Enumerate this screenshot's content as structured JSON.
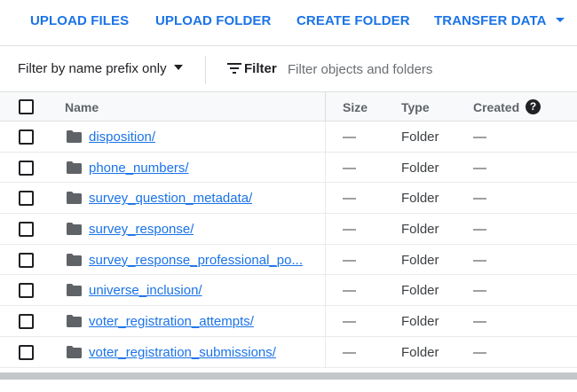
{
  "toolbar": {
    "upload_files": "UPLOAD FILES",
    "upload_folder": "UPLOAD FOLDER",
    "create_folder": "CREATE FOLDER",
    "transfer_data": "TRANSFER DATA"
  },
  "filterbar": {
    "prefix_option": "Filter by name prefix only",
    "filter_label": "Filter",
    "filter_placeholder": "Filter objects and folders"
  },
  "table": {
    "columns": {
      "name": "Name",
      "size": "Size",
      "type": "Type",
      "created": "Created"
    },
    "help_glyph": "?",
    "rows": [
      {
        "name": "disposition/",
        "size": "—",
        "type": "Folder",
        "created": "—"
      },
      {
        "name": "phone_numbers/",
        "size": "—",
        "type": "Folder",
        "created": "—"
      },
      {
        "name": "survey_question_metadata/",
        "size": "—",
        "type": "Folder",
        "created": "—"
      },
      {
        "name": "survey_response/",
        "size": "—",
        "type": "Folder",
        "created": "—"
      },
      {
        "name": "survey_response_professional_po...",
        "size": "—",
        "type": "Folder",
        "created": "—"
      },
      {
        "name": "universe_inclusion/",
        "size": "—",
        "type": "Folder",
        "created": "—"
      },
      {
        "name": "voter_registration_attempts/",
        "size": "—",
        "type": "Folder",
        "created": "—"
      },
      {
        "name": "voter_registration_submissions/",
        "size": "—",
        "type": "Folder",
        "created": "—"
      }
    ]
  },
  "colors": {
    "accent": "#1a73e8",
    "text": "#202124",
    "header_bg": "#f8f9fa"
  },
  "icons": {
    "dropdown": "caret-down-icon",
    "filter": "filter-lines-icon",
    "help": "help-circle-icon",
    "folder": "folder-icon",
    "checkbox": "checkbox-unchecked"
  }
}
